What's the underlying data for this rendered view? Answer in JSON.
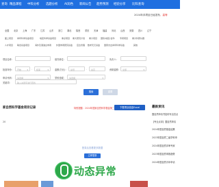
{
  "nav": {
    "items": [
      "查询",
      "精品课程",
      "中科分析",
      "选题分析",
      "AI润色",
      "新闻公告",
      "趋势预测",
      "经验分享",
      "比科查询"
    ],
    "active_index": 1
  },
  "notice": {
    "text_prefix": "2024年评项目已经发布",
    "text_suffix": "，高等"
  },
  "provinces": [
    "全国",
    "北京",
    "上海",
    "广东",
    "江苏",
    "山东",
    "浙江",
    "湖北",
    "陕西",
    "重庆",
    "天津",
    "福建",
    "河北",
    "山西",
    "安徽",
    "四川",
    "辽宁"
  ],
  "categories_row1": [
    "面上项目",
    "青年科学基金项目",
    "地区科学基金项目",
    "重点项目",
    "重大研究计划",
    "重大项目",
    "国际(地区)合作",
    "专项项目",
    "重大科研仪器"
  ],
  "categories_row2": [
    "人才项目",
    "联合基金项目",
    "海外及港澳台学者",
    "外国学者研究基金",
    "应急管理",
    "数学天元基金",
    "国家杰出青年科学基金",
    "其他"
  ],
  "form": {
    "row1": {
      "label_a": "项目名称：",
      "label_b": "依托单位：",
      "label_c": "负责人："
    },
    "row2": {
      "label_a": "批准年份：",
      "placeholder_a": "开始",
      "placeholder_b": "结束",
      "label_b": "金额(万元)：",
      "placeholder_c": "最低",
      "placeholder_d": "最高",
      "label_c": "资助金额：",
      "placeholder_e": "全部"
    },
    "row3": {
      "label_a": "申请代码：",
      "placeholder_a": "请选择",
      "label_b": "学科领域：",
      "placeholder_b": "请选择"
    },
    "row4": {
      "label_a": "关键词：",
      "placeholder_a": "输入关键字进行查找"
    }
  },
  "buttons": {
    "search": "搜索",
    "reset": "重置"
  },
  "section": {
    "title": "家自然科学基金项目记录",
    "warning": "特别提醒：2024年国家自然科学基金第二批申请结果已发布",
    "download": "下载项目信息Excel"
  },
  "results": {
    "login_prompt": "登录后查看更多数据",
    "login_button": "立即登录",
    "page_count": "20"
  },
  "sidebar": {
    "title": "最新资讯",
    "items": [
      "国自然申请书如何写出亮点",
      "【专业点评】国自然申请",
      "2024年国自然基金结果",
      "2023年国自然二级学科申",
      "2024年国自然评审专家",
      "2023年国自然申报趋势",
      "2024年国自然青年申请"
    ]
  },
  "watermark": {
    "text": "动态异常"
  },
  "colors": {
    "nav_bg": "#1f6fe0",
    "primary": "#2b6fd8",
    "warning": "#e53935",
    "watermark_green": "#2ea84a"
  }
}
